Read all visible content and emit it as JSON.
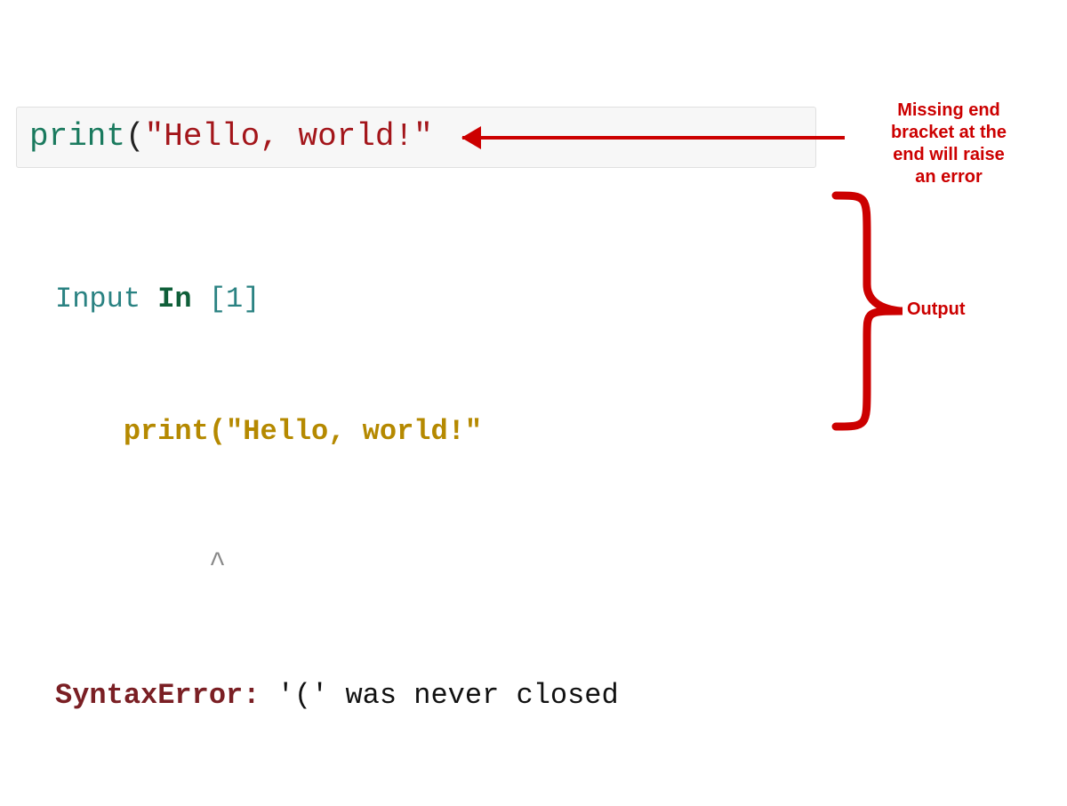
{
  "colors": {
    "annotation": "#cc0000",
    "func": "#1a7a5e",
    "string": "#a3151a",
    "error_name": "#7a1f24",
    "code_hl": "#b58900",
    "input_word": "#2a8282"
  },
  "cell": {
    "tokens": {
      "func": "print",
      "lparen": "(",
      "string": "\"Hello, world!\""
    }
  },
  "output": {
    "input_word": "Input ",
    "in_word": "In ",
    "bracket_open": "[",
    "num": "1",
    "bracket_close": "]",
    "echo_indent": "    ",
    "echo": "print(\"Hello, world!\"",
    "caret_indent": "         ",
    "caret": "^",
    "error_name": "SyntaxError:",
    "error_msg": " '(' was never closed"
  },
  "annotations": {
    "a1_line1": "Missing end",
    "a1_line2": "bracket at the",
    "a1_line3": "end will raise",
    "a1_line4": "an error",
    "a2": "Output"
  }
}
